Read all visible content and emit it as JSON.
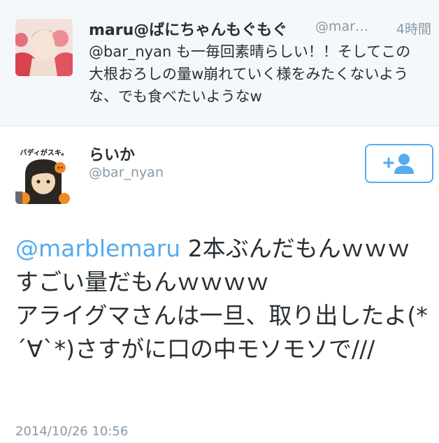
{
  "reply_tweet": {
    "display_name": "maru@ばにちゃんもぐもぐ",
    "handle": "@mar…",
    "time": "4時間",
    "text": "@bar_nyan も一毎回素晴らしい！！そしてこの大根おろしの量w崩れていく様をみたくないような、でも食べたいようなw"
  },
  "main_tweet": {
    "display_name": "らいか",
    "handle": "@bar_nyan",
    "avatar_text": "バディがスキ。",
    "mention": "@marblemaru",
    "text_line1": " 2本ぶんだもんｗｗｗすごい量だもんｗｗｗｗ",
    "text_line2": "アライグマさんは一旦、取り出したよ(*´∀`*)さすがに口の中モソモソで///",
    "timestamp": "2014/10/26 10:56"
  },
  "follow_button": {
    "icon": "add-user-icon"
  },
  "colors": {
    "link": "#55acee",
    "muted": "#8899a6",
    "text": "#292f33",
    "reply_bg": "#f5f8fa"
  }
}
